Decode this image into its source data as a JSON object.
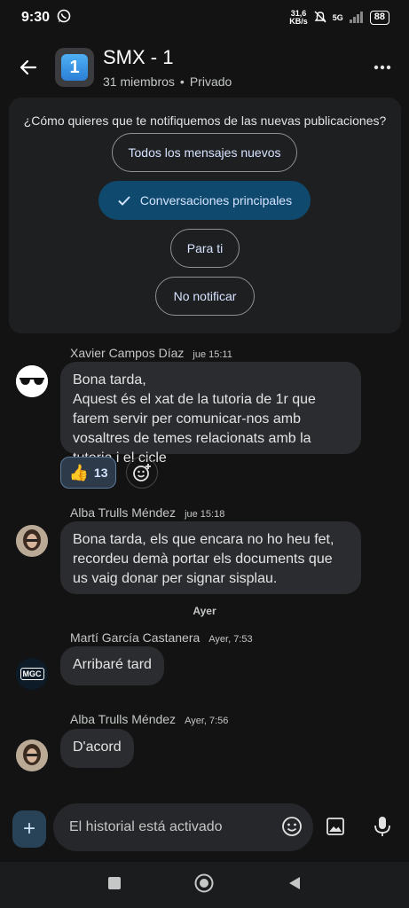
{
  "status_bar": {
    "time": "9:30",
    "net_speed_value": "31,6",
    "net_speed_unit": "KB/s",
    "network_type": "5G",
    "battery": "88"
  },
  "header": {
    "title": "SMX - 1",
    "space_emoji": "1",
    "members": "31 miembros",
    "privacy": "Privado"
  },
  "notifications": {
    "question": "¿Cómo quieres que te notifiquemos de las nuevas publicaciones?",
    "options": [
      {
        "label": "Todos los mensajes nuevos",
        "selected": false
      },
      {
        "label": "Conversaciones principales",
        "selected": true
      },
      {
        "label": "Para ti",
        "selected": false
      },
      {
        "label": "No notificar",
        "selected": false
      }
    ]
  },
  "messages": [
    {
      "author": "Xavier Campos Díaz",
      "time": "jue 15:11",
      "text": "Bona tarda,\nAquest és el xat de la tutoria de 1r que farem servir per comunicar-nos amb vosaltres de temes relacionats amb la tutoria i el cicle",
      "reaction": {
        "emoji": "👍",
        "count": "13"
      }
    },
    {
      "author": "Alba Trulls Méndez",
      "time": "jue 15:18",
      "text": "Bona tarda, els que encara no ho heu fet, recordeu demà portar els documents que us vaig donar per signar sisplau."
    },
    {
      "author": "Martí García Castanera",
      "time": "Ayer, 7:53",
      "text": "Arribaré tard",
      "avatar_text": "MGC"
    },
    {
      "author": "Alba Trulls Méndez",
      "time": "Ayer, 7:56",
      "text": "D'acord"
    }
  ],
  "day_divider": "Ayer",
  "composer": {
    "plus": "+",
    "placeholder": "El historial está activado"
  },
  "colors": {
    "background": "#131314",
    "bubble": "#2b2c2f",
    "selected_option": "#0f4a6e",
    "reaction_bg": "#2d3a4a"
  }
}
